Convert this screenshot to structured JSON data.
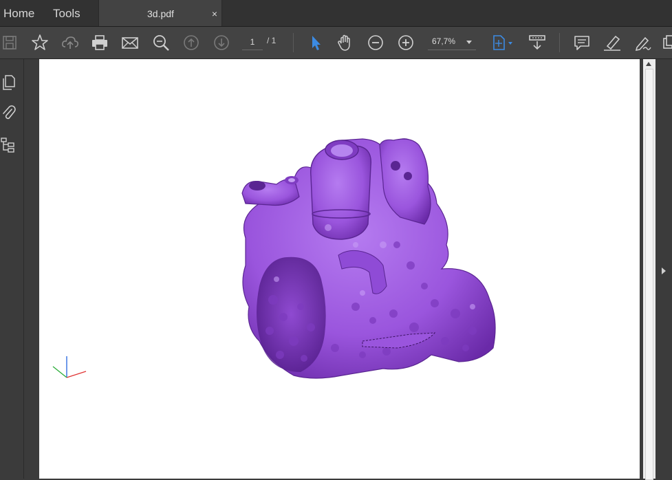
{
  "tabs": {
    "home": "Home",
    "tools": "Tools",
    "document": "3d.pdf",
    "close": "×"
  },
  "toolbar": {
    "current_page": "1",
    "page_total": "/ 1",
    "zoom": "67,7%",
    "icons": [
      "save-icon",
      "star-icon",
      "upload-cloud-icon",
      "print-icon",
      "email-icon",
      "find-icon",
      "prev-page-icon",
      "next-page-icon",
      "select-cursor-icon",
      "hand-tool-icon",
      "zoom-out-icon",
      "zoom-in-icon",
      "fit-page-icon",
      "scroll-mode-icon",
      "comment-icon",
      "highlight-icon",
      "sign-icon",
      "share-icon"
    ]
  },
  "sidebar": {
    "icons": [
      "pages-icon",
      "attachment-icon",
      "bookmarks-icon"
    ]
  },
  "colors": {
    "model_purple": "#a05ee0",
    "accent_blue": "#3c8be3",
    "chrome_dark": "#323232",
    "toolbar": "#434343"
  }
}
